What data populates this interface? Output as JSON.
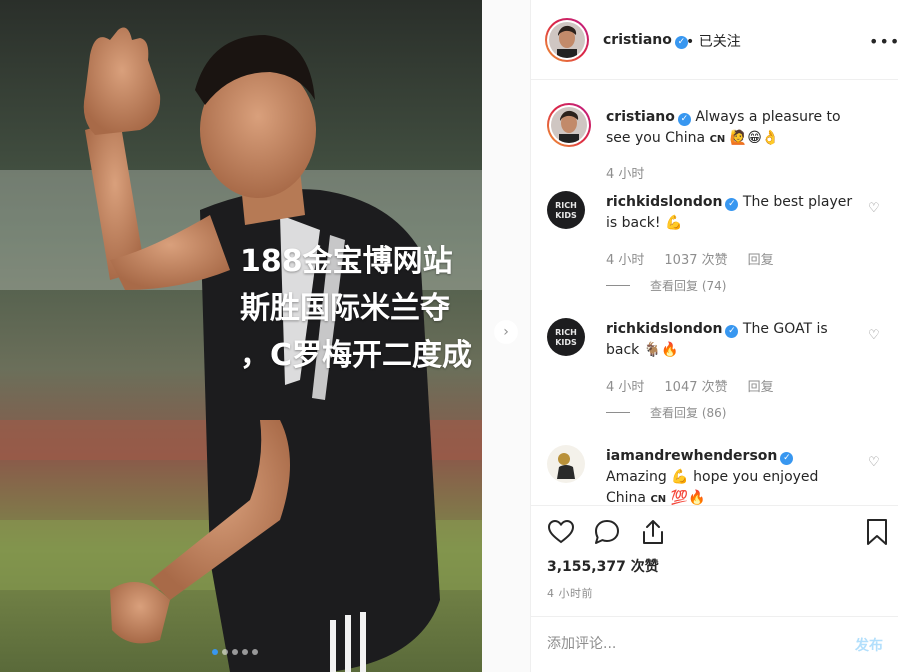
{
  "colors": {
    "accent": "#3897f0",
    "text": "#262626",
    "muted": "#8e8e8e",
    "post_disabled": "#b2dffc"
  },
  "photo": {
    "overlay_headline": "188金宝博网站\n斯胜国际米兰夺\n，C罗梅开二度成",
    "next_arrow": "›",
    "slide_count": 5,
    "active_slide": 1
  },
  "header": {
    "username": "cristiano",
    "verified_glyph": "✓",
    "follow_status": "• 已关注",
    "more_icon": "•••"
  },
  "comments": [
    {
      "username": "cristiano",
      "text": "Always a pleasure to see you China",
      "flag": "CN",
      "emojis": "🙋😁👌",
      "time": "4 小时",
      "likes": "",
      "reply": "",
      "view_replies": ""
    },
    {
      "username": "richkidslondon",
      "text": "The best player is back!",
      "flag": "",
      "emojis": "💪",
      "time": "4 小时",
      "likes": "1037 次赞",
      "reply": "回复",
      "view_replies": "查看回复 (74)"
    },
    {
      "username": "richkidslondon",
      "text": "The GOAT is back",
      "flag": "",
      "emojis": "🐐🔥",
      "time": "4 小时",
      "likes": "1047 次赞",
      "reply": "回复",
      "view_replies": "查看回复 (86)"
    },
    {
      "username": "iamandrewhenderson",
      "text": "Amazing 💪 hope you enjoyed China",
      "flag": "CN",
      "emojis": "💯🔥",
      "time": "",
      "likes": "",
      "reply": "",
      "view_replies": ""
    }
  ],
  "actions": {
    "like_count": "3,155,377 次赞",
    "time_ago": "4 小时前"
  },
  "add_comment": {
    "placeholder": "添加评论...",
    "post_label": "发布"
  },
  "icons": {
    "heart": "heart-icon",
    "comment": "comment-icon",
    "share": "share-icon",
    "bookmark": "bookmark-icon",
    "more": "more-icon",
    "comment_like": "small-heart-icon"
  }
}
